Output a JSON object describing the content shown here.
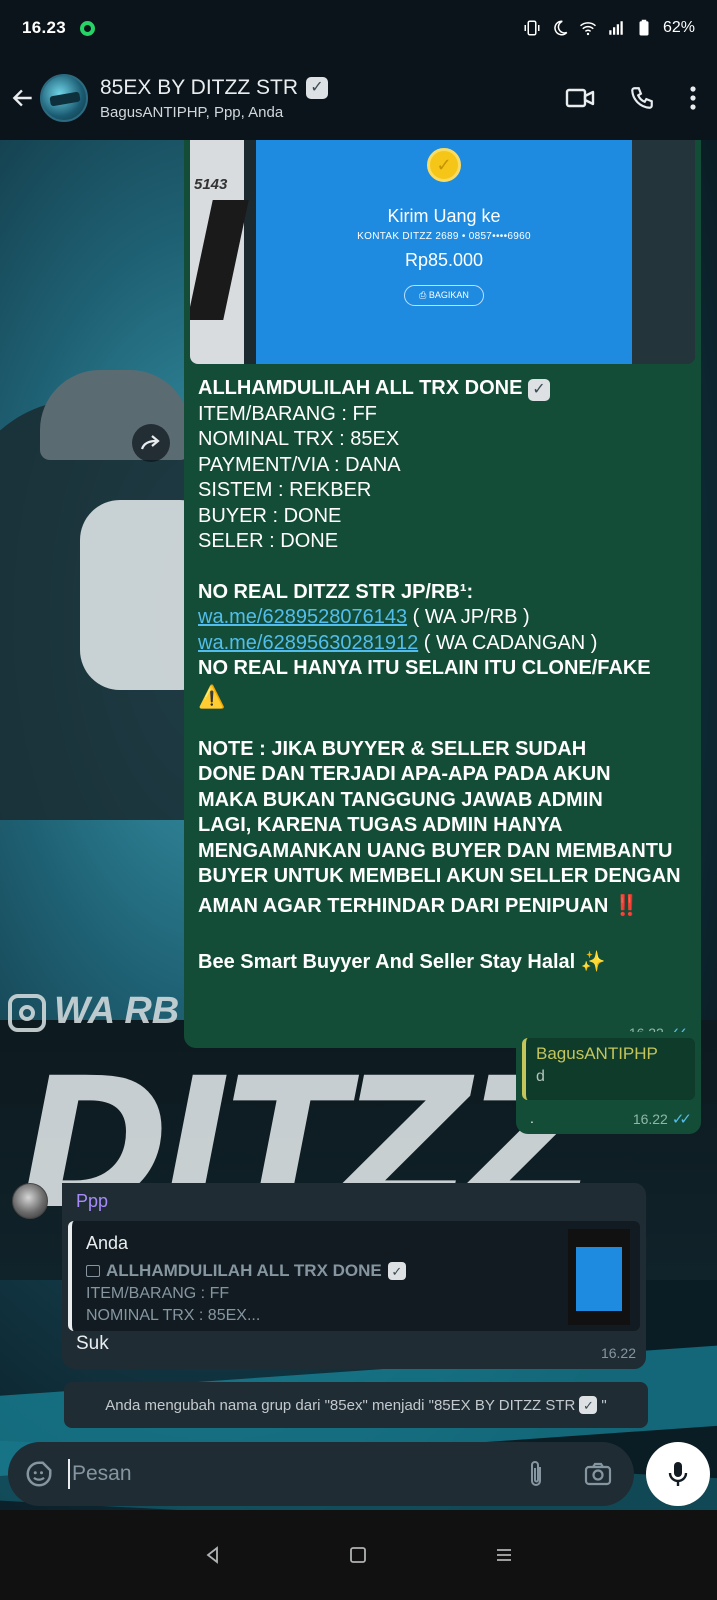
{
  "status_bar": {
    "time": "16.23",
    "battery": "62%"
  },
  "header": {
    "group_name": "85EX BY DITZZ STR",
    "members": "BagusANTIPHP, Ppp, Anda"
  },
  "background": {
    "overlay_text": "WA RB :",
    "logo_text": "DITZZ"
  },
  "outgoing_message": {
    "receipt": {
      "side_text": "5143",
      "title": "Kirim Uang ke",
      "contact": "KONTAK DITZZ 2689 • 0857••••6960",
      "amount": "Rp85.000",
      "share_button": "BAGIKAN"
    },
    "lines": {
      "heading": "ALLHAMDULILAH ALL TRX DONE",
      "item": "ITEM/BARANG : FF",
      "nominal": "NOMINAL TRX : 85EX",
      "payment": "PAYMENT/VIA : DANA",
      "sistem": "SISTEM : REKBER",
      "buyer": "BUYER : DONE",
      "seler": "SELER : DONE",
      "no_real_heading": "NO REAL DITZZ STR JP/RB¹:",
      "link1": "wa.me/6289528076143",
      "link1_note": " ( WA JP/RB )",
      "link2": "wa.me/62895630281912",
      "link2_note": " ( WA CADANGAN )",
      "no_real_only": "NO REAL HANYA ITU SELAIN ITU CLONE/FAKE",
      "warning_emoji": "⚠️",
      "note1": "NOTE : JIKA BUYYER & SELLER SUDAH",
      "note2": "DONE DAN TERJADI APA-APA PADA AKUN",
      "note3": "MAKA BUKAN TANGGUNG JAWAB ADMIN",
      "note4": "LAGI, KARENA TUGAS ADMIN HANYA",
      "note5": "MENGAMANKAN UANG BUYER DAN MEMBANTU",
      "note6": "BUYER UNTUK MEMBELI AKUN SELLER DENGAN",
      "note7": "AMAN AGAR TERHINDAR DARI PENIPUAN",
      "alert_emoji": "‼️",
      "closing": "Bee Smart Buyyer And Seller Stay Halal",
      "sparkle_emoji": "✨"
    },
    "time": "16.22"
  },
  "reply_message": {
    "quoted_name": "BagusANTIPHP",
    "quoted_text": "d",
    "body": ".",
    "time": "16.22"
  },
  "incoming_message": {
    "sender": "Ppp",
    "quoted_name": "Anda",
    "quoted_line1": "ALLHAMDULILAH ALL TRX DONE",
    "quoted_line2": "ITEM/BARANG : FF",
    "quoted_line3": "NOMINAL TRX : 85EX...",
    "body": "Suk",
    "time": "16.22"
  },
  "system_message": {
    "text": "Anda mengubah nama grup dari \"85ex\" menjadi \"85EX BY DITZZ STR",
    "suffix": "\""
  },
  "composer": {
    "placeholder": "Pesan"
  },
  "icons": {
    "verified_check": "✓",
    "coin": "✓"
  },
  "colors": {
    "outgoing_bubble": "#144d37",
    "incoming_bubble": "#1f2c34",
    "link": "#53bdeb",
    "read_ticks": "#53bdeb"
  }
}
